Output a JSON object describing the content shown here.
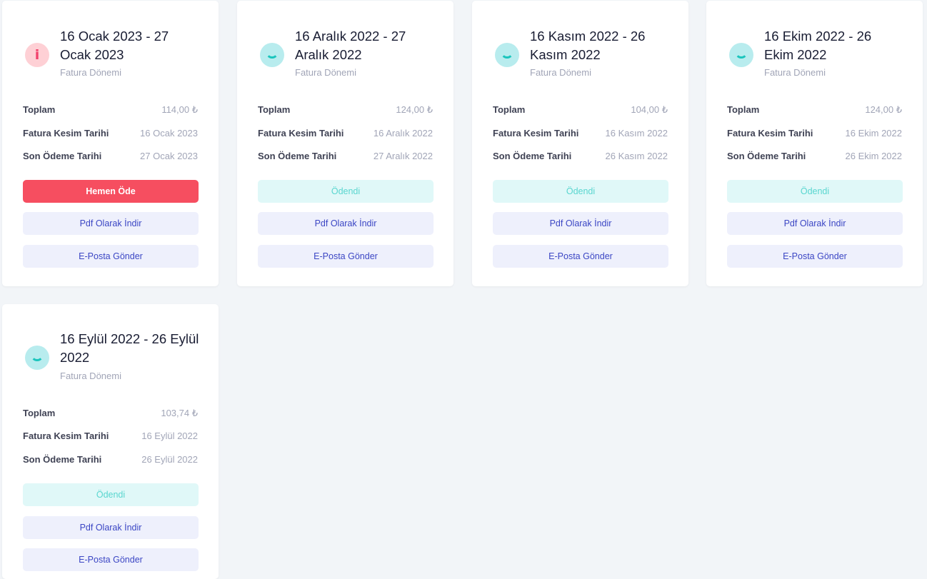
{
  "invoices": [
    {
      "status": "unpaid",
      "status_icon": "info-icon",
      "icon_glyph": "i",
      "title": "16 Ocak 2023 - 27 Ocak 2023",
      "subtitle": "Fatura Dönemi",
      "rows": [
        {
          "label": "Toplam",
          "value": "114,00 ₺"
        },
        {
          "label": "Fatura Kesim Tarihi",
          "value": "16 Ocak 2023"
        },
        {
          "label": "Son Ödeme Tarihi",
          "value": "27 Ocak 2023"
        }
      ],
      "action_label": "Hemen Öde",
      "pdf_label": "Pdf Olarak İndir",
      "email_label": "E-Posta Gönder"
    },
    {
      "status": "paid",
      "status_icon": "smile-icon",
      "title": "16 Aralık 2022 - 27 Aralık 2022",
      "subtitle": "Fatura Dönemi",
      "rows": [
        {
          "label": "Toplam",
          "value": "124,00 ₺"
        },
        {
          "label": "Fatura Kesim Tarihi",
          "value": "16 Aralık 2022"
        },
        {
          "label": "Son Ödeme Tarihi",
          "value": "27 Aralık 2022"
        }
      ],
      "action_label": "Ödendi",
      "pdf_label": "Pdf Olarak İndir",
      "email_label": "E-Posta Gönder"
    },
    {
      "status": "paid",
      "status_icon": "smile-icon",
      "title": "16 Kasım 2022 - 26 Kasım 2022",
      "subtitle": "Fatura Dönemi",
      "rows": [
        {
          "label": "Toplam",
          "value": "104,00 ₺"
        },
        {
          "label": "Fatura Kesim Tarihi",
          "value": "16 Kasım 2022"
        },
        {
          "label": "Son Ödeme Tarihi",
          "value": "26 Kasım 2022"
        }
      ],
      "action_label": "Ödendi",
      "pdf_label": "Pdf Olarak İndir",
      "email_label": "E-Posta Gönder"
    },
    {
      "status": "paid",
      "status_icon": "smile-icon",
      "title": "16 Ekim 2022 - 26 Ekim 2022",
      "subtitle": "Fatura Dönemi",
      "rows": [
        {
          "label": "Toplam",
          "value": "124,00 ₺"
        },
        {
          "label": "Fatura Kesim Tarihi",
          "value": "16 Ekim 2022"
        },
        {
          "label": "Son Ödeme Tarihi",
          "value": "26 Ekim 2022"
        }
      ],
      "action_label": "Ödendi",
      "pdf_label": "Pdf Olarak İndir",
      "email_label": "E-Posta Gönder"
    },
    {
      "status": "paid",
      "status_icon": "smile-icon",
      "title": "16 Eylül 2022 - 26 Eylül 2022",
      "subtitle": "Fatura Dönemi",
      "rows": [
        {
          "label": "Toplam",
          "value": "103,74 ₺"
        },
        {
          "label": "Fatura Kesim Tarihi",
          "value": "16 Eylül 2022"
        },
        {
          "label": "Son Ödeme Tarihi",
          "value": "26 Eylül 2022"
        }
      ],
      "action_label": "Ödendi",
      "pdf_label": "Pdf Olarak İndir",
      "email_label": "E-Posta Gönder"
    }
  ],
  "colors": {
    "page_background": "#f2f5f8",
    "pay_button": "#f64e60",
    "paid_badge_bg": "#e0f8f8",
    "paid_badge_text": "#59d6cf",
    "soft_button_bg": "#eef0fc",
    "soft_button_text": "#3b46c4",
    "unpaid_icon_bg": "#fed0d5",
    "unpaid_icon_fg": "#f1416c",
    "paid_icon_bg": "#b8ecee",
    "paid_icon_fg": "#1bc5bd"
  }
}
